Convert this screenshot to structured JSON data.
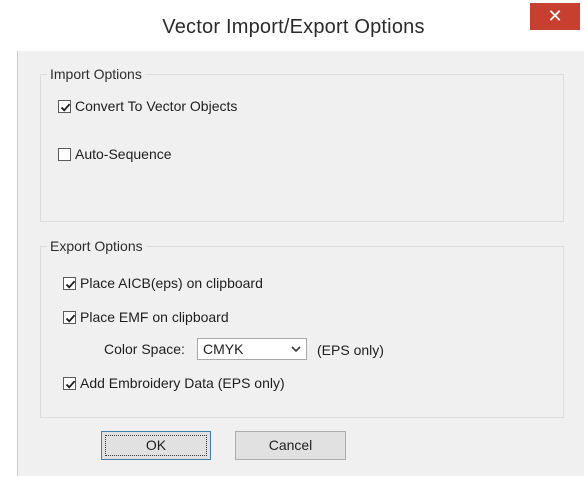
{
  "window": {
    "title": "Vector Import/Export Options",
    "close_symbol": "✕"
  },
  "import_group": {
    "legend": "Import Options",
    "convert_to_vector": {
      "label": "Convert To Vector Objects",
      "checked": true
    },
    "auto_sequence": {
      "label": "Auto-Sequence",
      "checked": false
    }
  },
  "export_group": {
    "legend": "Export Options",
    "place_aicb": {
      "label": "Place AICB(eps) on clipboard",
      "checked": true
    },
    "place_emf": {
      "label": "Place EMF on clipboard",
      "checked": true
    },
    "color_space": {
      "label": "Color Space:",
      "value": "CMYK",
      "note": "(EPS only)"
    },
    "add_embroidery": {
      "label": "Add Embroidery Data (EPS only)",
      "checked": true
    }
  },
  "buttons": {
    "ok": "OK",
    "cancel": "Cancel"
  },
  "colors": {
    "close_button": "#c7402f",
    "dialog_bg": "#f0f0f0",
    "default_button_border": "#3c7fb1"
  },
  "icons": {
    "close": "close-icon",
    "check": "checkmark-icon",
    "dropdown": "chevron-down-icon"
  }
}
